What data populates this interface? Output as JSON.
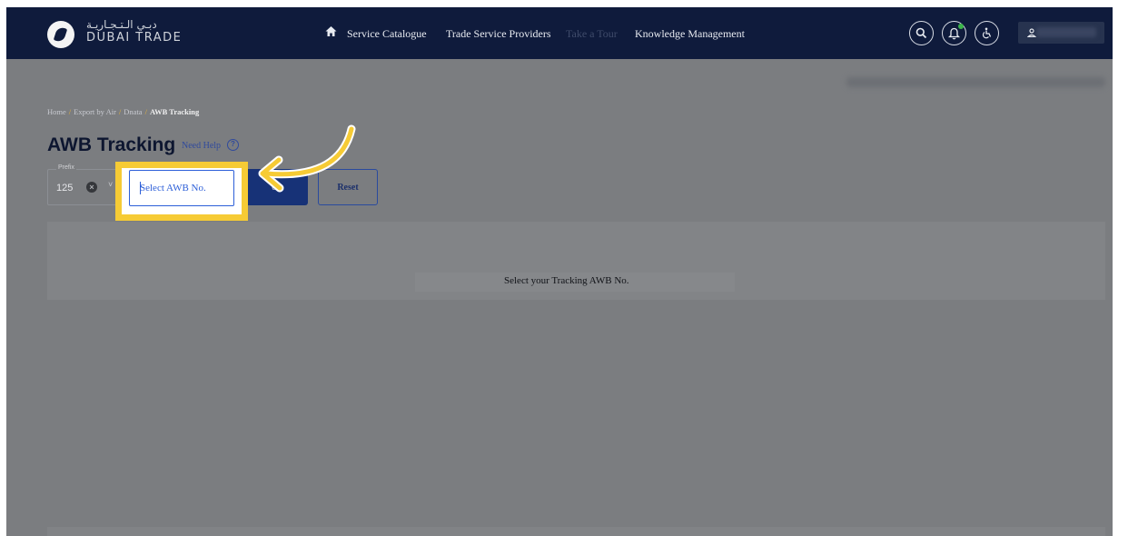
{
  "header": {
    "logo_arabic": "دبـي الـتـجـاريـة",
    "logo_english": "DUBAI TRADE",
    "nav": [
      {
        "label": "Service Catalogue"
      },
      {
        "label": "Trade Service Providers"
      },
      {
        "label": "Take a Tour"
      },
      {
        "label": "Knowledge Management"
      }
    ],
    "icons": [
      "home-icon",
      "search-icon",
      "bell-icon",
      "accessibility-icon",
      "user-icon"
    ]
  },
  "breadcrumb": {
    "items": [
      "Home",
      "Export by Air",
      "Dnata"
    ],
    "current": "AWB Tracking",
    "separator": "/"
  },
  "page": {
    "title": "AWB Tracking",
    "help_label": "Need Help",
    "help_icon": "?"
  },
  "form": {
    "prefix_label": "Prefix",
    "prefix_value": "125",
    "awb_placeholder": "Select AWB No.",
    "track_label": "ck",
    "reset_label": "Reset"
  },
  "panel": {
    "message": "Select your Tracking AWB No."
  },
  "colors": {
    "header_bg": "#0f1b3c",
    "overlay": "#7b7d80",
    "highlight": "#f6cb35",
    "primary": "#173277"
  }
}
